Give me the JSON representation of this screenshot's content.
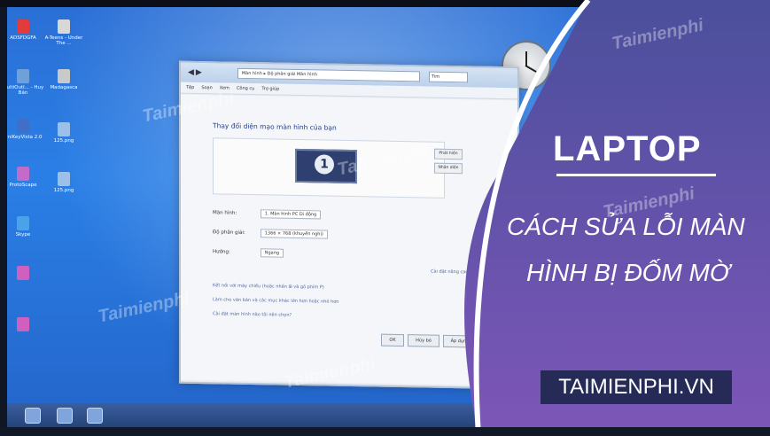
{
  "desktop": {
    "icons": [
      {
        "label": "ADSFDGFA",
        "color": "#e23b3b"
      },
      {
        "label": "A-Teens - Under The ...",
        "color": "#d8d8d8"
      },
      {
        "label": "MultiOutl... - Huy Bản",
        "color": "#6fa0d8"
      },
      {
        "label": "Madagasca",
        "color": "#c9c9c9"
      },
      {
        "label": "UniKeyVista 2.0",
        "color": "#3f6fc8"
      },
      {
        "label": "125.png",
        "color": "#9cc0ea"
      },
      {
        "label": "ProtoScape",
        "color": "#c46ac9"
      },
      {
        "label": "125.png",
        "color": "#9cc0ea"
      },
      {
        "label": "Skype",
        "color": "#4aa3e8"
      },
      {
        "label": "",
        "color": "#d060c0"
      },
      {
        "label": "",
        "color": "#d060c0"
      }
    ]
  },
  "window": {
    "address": "Màn hình  ▸  Độ phân giải Màn hình",
    "search_placeholder": "Tìm",
    "menu": [
      "Tệp",
      "Soạn",
      "Xem",
      "Công cụ",
      "Trợ giúp"
    ],
    "heading": "Thay đổi diện mạo màn hình của bạn",
    "monitor_number": "1",
    "detect_button": "Phát hiện",
    "identify_button": "Nhận diện",
    "display_label": "Màn hình:",
    "display_value": "1. Màn hình PC Di động",
    "resolution_label": "Độ phân giải:",
    "resolution_value": "1366 × 768 (khuyến nghị)",
    "orientation_label": "Hướng:",
    "orientation_value": "Ngang",
    "advanced_link": "Cài đặt nâng cao",
    "link1": "Kết nối với máy chiếu (hoặc nhấn  ⊞  và gõ phím P)",
    "link2": "Làm cho văn bản và các mục khác lớn hơn hoặc nhỏ hơn",
    "link3": "Cài đặt màn hình nào tôi nên chọn?",
    "ok_button": "OK",
    "cancel_button": "Hủy bỏ",
    "apply_button": "Áp dụng"
  },
  "brand": {
    "title": "LAPTOP",
    "subtitle_line1": "CÁCH SỬA LỖI MÀN",
    "subtitle_line2": "HÌNH BỊ ĐỐM MỜ",
    "site": "TAIMIENPHI.VN",
    "watermark": "Taimienphi",
    "panel_color_top": "#4b4f9c",
    "panel_color_bottom": "#7d56b8"
  }
}
